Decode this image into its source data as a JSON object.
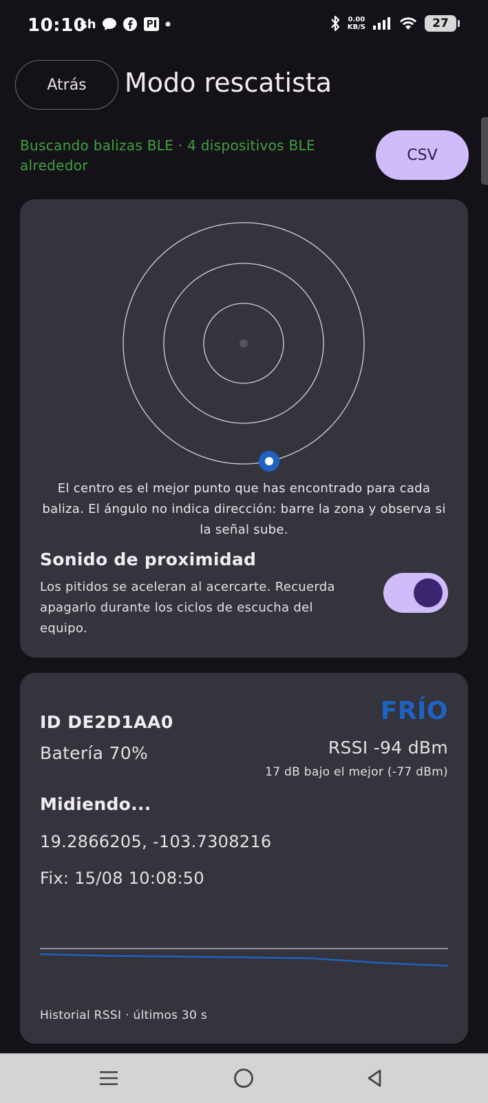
{
  "status_bar": {
    "time": "10:10",
    "notifications": [
      "sh",
      "chat-icon",
      "facebook-icon",
      "parking-icon"
    ],
    "net_speed": [
      "0.00",
      "KB/S"
    ],
    "battery": "27"
  },
  "header": {
    "back_label": "Atrás",
    "title": "Modo rescatista",
    "scan_status": "Buscando balizas BLE · 4 dispositivos BLE alrededor",
    "csv_label": "CSV",
    "status_color": "#3fa13f"
  },
  "radar": {
    "caption": "El centro es el mejor punto que has encontrado para cada baliza. El ángulo no indica dirección: barre la zona y observa si la señal sube.",
    "sound_title": "Sonido de proximidad",
    "sound_desc": "Los pitidos se aceleran al acercarte. Recuerda apagarlo durante los ciclos de escucha del equipo.",
    "sound_enabled": true,
    "beacon_color": "#1e63c4"
  },
  "beacon": {
    "id": "ID DE2D1AA0",
    "state": "FRÍO",
    "battery": "Batería 70%",
    "rssi": "RSSI -94 dBm",
    "delta": "17 dB bajo el mejor (-77 dBm)",
    "measuring": "Midiendo...",
    "coords": "19.2866205, -103.7308216",
    "fix": "Fix: 15/08 10:08:50",
    "history_label": "Historial RSSI · últimos 30 s",
    "state_color": "#1e63c4"
  },
  "chart_data": {
    "type": "line",
    "title": "",
    "series": [
      {
        "values": [
          0.0,
          0.08,
          0.11,
          0.15,
          0.19,
          0.4,
          0.53
        ]
      }
    ]
  },
  "navbar": {
    "buttons": [
      "menu-icon",
      "home-icon",
      "back-icon"
    ]
  }
}
